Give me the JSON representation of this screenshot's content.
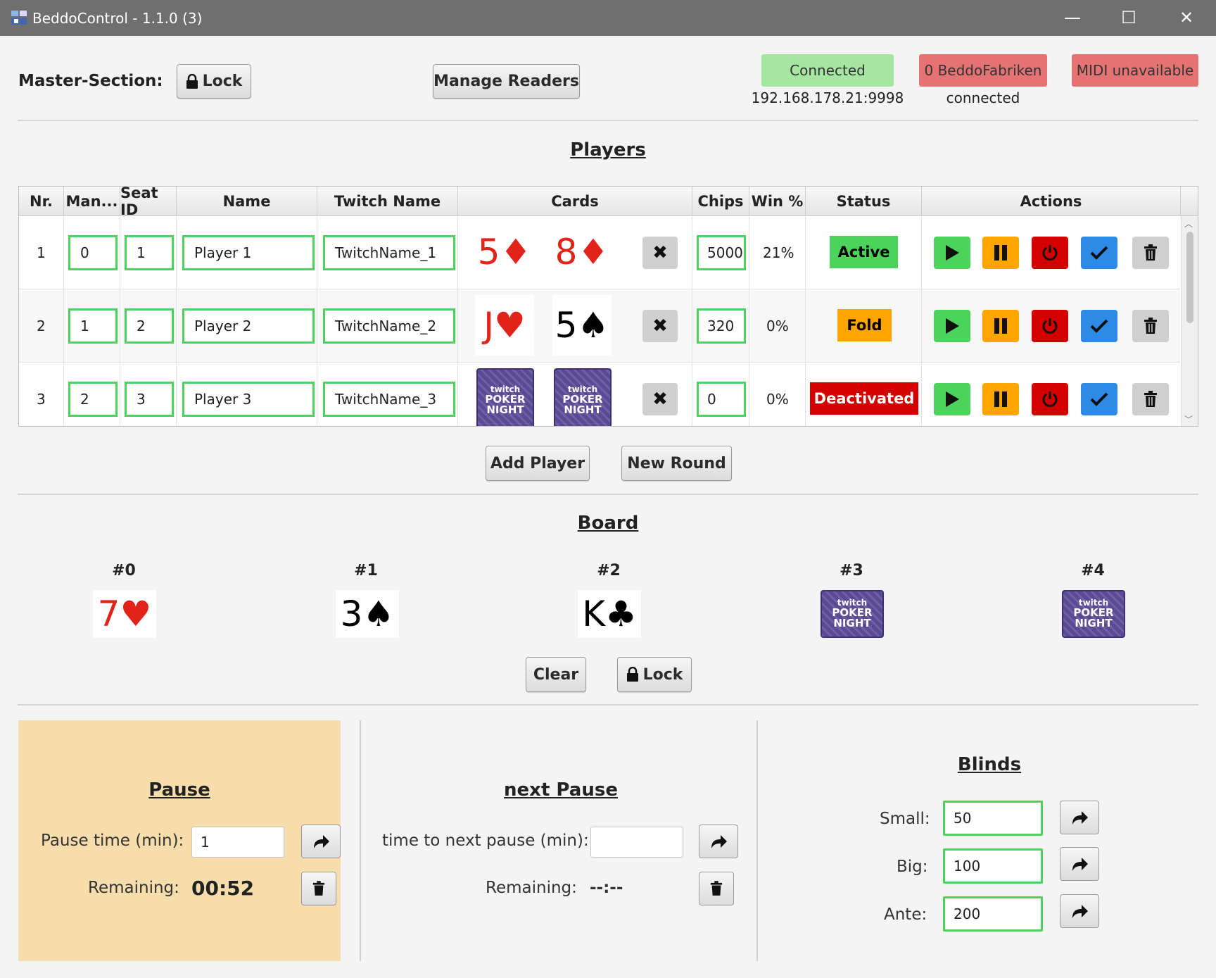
{
  "window": {
    "title": "BeddoControl - 1.1.0 (3)",
    "minimize": "—",
    "maximize": "☐",
    "close": "✕"
  },
  "master": {
    "label": "Master-Section:",
    "lock_button": "Lock",
    "manage_readers_button": "Manage Readers",
    "connection_status": "Connected",
    "connection_address": "192.168.178.21:9998",
    "fabriken_status": "0 BeddoFabriken",
    "fabriken_sub": "connected",
    "midi_status": "MIDI unavailable",
    "colors": {
      "connected": "#a5e6a2",
      "error": "#e57373"
    }
  },
  "players": {
    "title": "Players",
    "columns": [
      "Nr.",
      "Man...",
      "Seat ID",
      "Name",
      "Twitch Name",
      "Cards",
      "Chips",
      "Win %",
      "Status",
      "Actions"
    ],
    "rows": [
      {
        "nr": "1",
        "manager": "0",
        "seat": "1",
        "name": "Player 1",
        "twitch": "TwitchName_1",
        "cards": [
          {
            "rank": "5",
            "suit": "♦",
            "color": "red"
          },
          {
            "rank": "8",
            "suit": "♦",
            "color": "red"
          }
        ],
        "chips": "5000",
        "win": "21%",
        "status": "Active",
        "status_color": "#4cd35c",
        "status_text_color": "#000"
      },
      {
        "nr": "2",
        "manager": "1",
        "seat": "2",
        "name": "Player 2",
        "twitch": "TwitchName_2",
        "cards": [
          {
            "rank": "J",
            "suit": "♥",
            "color": "red"
          },
          {
            "rank": "5",
            "suit": "♠",
            "color": "black"
          }
        ],
        "chips": "320",
        "win": "0%",
        "status": "Fold",
        "status_color": "#ffa500",
        "status_text_color": "#000"
      },
      {
        "nr": "3",
        "manager": "2",
        "seat": "3",
        "name": "Player 3",
        "twitch": "TwitchName_3",
        "cards": [
          {
            "back": true
          },
          {
            "back": true
          }
        ],
        "chips": "0",
        "win": "0%",
        "status": "Deactivated",
        "status_color": "#d40000",
        "status_text_color": "#fff"
      }
    ],
    "card_back": {
      "line1": "twitch",
      "line2": "POKER",
      "line3": "NIGHT"
    },
    "remove_card_icon": "✖",
    "add_player_button": "Add Player",
    "new_round_button": "New Round"
  },
  "board": {
    "title": "Board",
    "slots": [
      {
        "label": "#0",
        "rank": "7",
        "suit": "♥",
        "color": "red"
      },
      {
        "label": "#1",
        "rank": "3",
        "suit": "♠",
        "color": "black"
      },
      {
        "label": "#2",
        "rank": "K",
        "suit": "♣",
        "color": "black"
      },
      {
        "label": "#3",
        "back": true
      },
      {
        "label": "#4",
        "back": true
      }
    ],
    "clear_button": "Clear",
    "lock_button": "Lock"
  },
  "pause": {
    "title": "Pause",
    "time_label": "Pause time (min):",
    "time_value": "1",
    "remaining_label": "Remaining:",
    "remaining_value": "00:52"
  },
  "next_pause": {
    "title": "next Pause",
    "time_label": "time to next pause (min):",
    "time_value": "",
    "remaining_label": "Remaining:",
    "remaining_value": "--:--"
  },
  "blinds": {
    "title": "Blinds",
    "small_label": "Small:",
    "small_value": "50",
    "big_label": "Big:",
    "big_value": "100",
    "ante_label": "Ante:",
    "ante_value": "200"
  },
  "icons": [
    "app-icon",
    "lock-icon",
    "play-icon",
    "pause-icon",
    "power-icon",
    "check-icon",
    "trash-icon",
    "forward-icon",
    "close-icon"
  ]
}
